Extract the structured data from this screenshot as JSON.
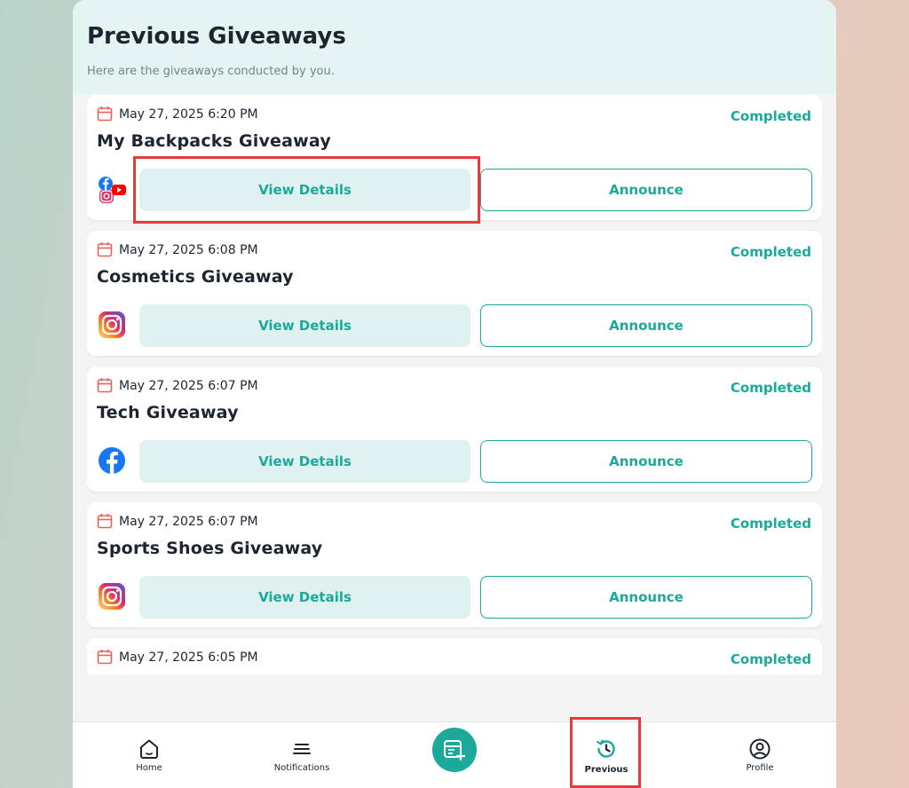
{
  "header": {
    "title": "Previous Giveaways",
    "subtitle": "Here are the giveaways conducted by you."
  },
  "giveaways": [
    {
      "date": "May 27, 2025 6:20 PM",
      "name": "My Backpacks Giveaway",
      "status": "Completed",
      "platforms": [
        "facebook",
        "instagram",
        "youtube"
      ],
      "view_label": "View Details",
      "announce_label": "Announce"
    },
    {
      "date": "May 27, 2025 6:08 PM",
      "name": "Cosmetics Giveaway",
      "status": "Completed",
      "platforms": [
        "instagram"
      ],
      "view_label": "View Details",
      "announce_label": "Announce"
    },
    {
      "date": "May 27, 2025 6:07 PM",
      "name": "Tech Giveaway",
      "status": "Completed",
      "platforms": [
        "facebook"
      ],
      "view_label": "View Details",
      "announce_label": "Announce"
    },
    {
      "date": "May 27, 2025 6:07 PM",
      "name": "Sports Shoes Giveaway",
      "status": "Completed",
      "platforms": [
        "instagram"
      ],
      "view_label": "View Details",
      "announce_label": "Announce"
    },
    {
      "date": "May 27, 2025 6:05 PM",
      "name": "",
      "status": "Completed",
      "platforms": [],
      "view_label": "",
      "announce_label": ""
    }
  ],
  "nav": {
    "items": [
      {
        "label": "Home",
        "icon": "home-icon"
      },
      {
        "label": "Notifications",
        "icon": "notifications-icon"
      },
      {
        "label": "",
        "icon": "create-giveaway-icon"
      },
      {
        "label": "Previous",
        "icon": "history-icon",
        "active": true
      },
      {
        "label": "Profile",
        "icon": "profile-icon"
      }
    ]
  },
  "colors": {
    "accent": "#1aa99a",
    "header_bg": "#e3f4f2",
    "view_button_bg": "#dff2f0",
    "highlight": "#e83a3a",
    "calendar_icon": "#e8625a"
  }
}
